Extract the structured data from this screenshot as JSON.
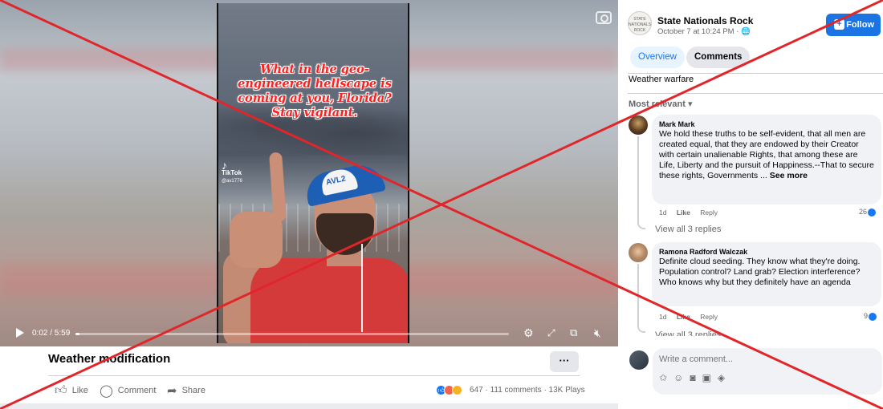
{
  "video": {
    "overlay_text": "What in the geo-engineered hellscape is coming at you, Florida? Stay vigilant.",
    "tiktok_label": "TikTok",
    "tiktok_handle": "@av1776",
    "cap_logo": "AVL2",
    "time": "0:02 / 5:59",
    "progress": 0.01
  },
  "post": {
    "title": "Weather modification",
    "more_label": "···",
    "actions": {
      "like": "Like",
      "comment": "Comment",
      "share": "Share"
    },
    "stats": "647 · 111 comments · 13K Plays"
  },
  "panel": {
    "page_name": "State Nationals Rock",
    "avatar_text": "STATE NATIONALS ROCK",
    "date": "October 7 at 10:24 PM · 🌐",
    "follow_label": "Follow",
    "tabs": [
      "Overview",
      "Comments"
    ],
    "description": "Weather warfare",
    "sort_label": "Most relevant ▾",
    "comments": [
      {
        "author": "Mark Mark",
        "text": "We hold these truths to be self-evident, that all men are created equal, that they are endowed by their Creator with certain unalienable Rights, that among these are Life, Liberty and the pursuit of Happiness.--That to secure these rights, Governments ...",
        "see_more": "See more",
        "age": "1d",
        "like": "Like",
        "reply": "Reply",
        "reaction_count": "26",
        "view_replies": "View all 3 replies"
      },
      {
        "author": "Ramona Radford Walczak",
        "text": "Definite cloud seeding. They know what they're doing. Population control? Land grab? Election interference? Who knows why but they definitely have an agenda",
        "age": "1d",
        "like": "Like",
        "reply": "Reply",
        "reaction_count": "9",
        "view_replies": "View all 3 replies"
      }
    ],
    "composer_placeholder": "Write a comment..."
  },
  "colors": {
    "accent": "#1877f2",
    "follow_bg": "#1b74e4",
    "overlay_cross": "#e0262b",
    "overlay_text": "#ff1f1f"
  },
  "icons": [
    "play-icon",
    "settings-icon",
    "fullscreen-icon",
    "miniplayer-icon",
    "mute-icon",
    "camera-icon",
    "like-icon",
    "comment-icon",
    "share-icon",
    "globe-icon",
    "sticker-icon",
    "emoji-icon",
    "photo-icon",
    "gif-icon",
    "avatar-sticker-icon"
  ]
}
